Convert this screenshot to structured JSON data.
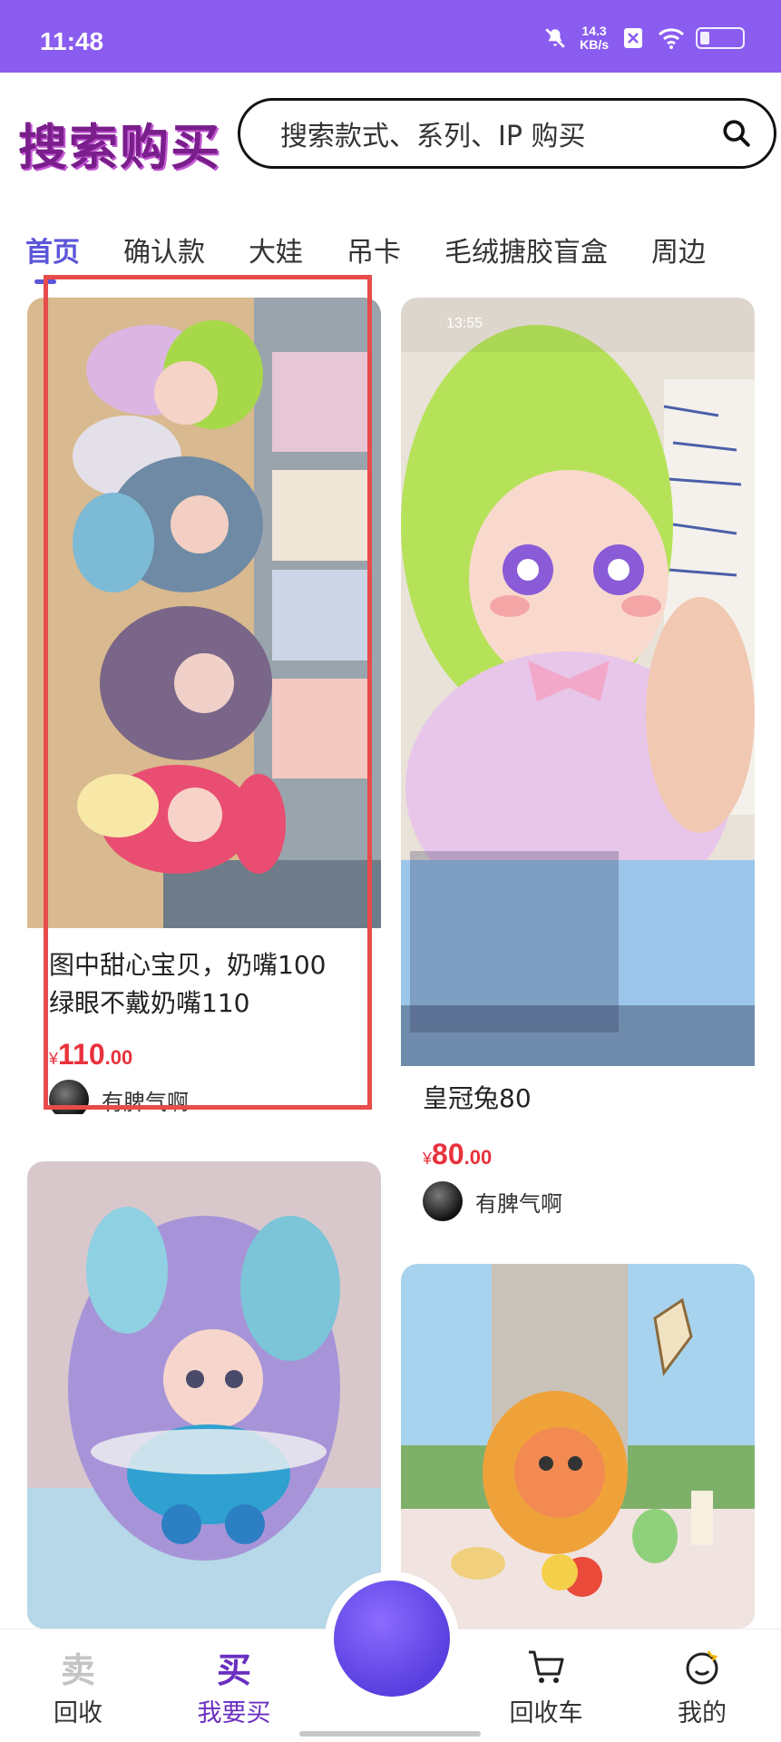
{
  "status_bar": {
    "time": "11:48",
    "net_speed_value": "14.3",
    "net_speed_unit": "KB/s",
    "icons": [
      "mute-icon",
      "no-sim-icon",
      "wifi-icon",
      "battery-icon"
    ]
  },
  "header": {
    "title": "搜索购买",
    "search_placeholder": "搜索款式、系列、IP 购买"
  },
  "tabs": [
    {
      "label": "首页",
      "active": true
    },
    {
      "label": "确认款",
      "active": false
    },
    {
      "label": "大娃",
      "active": false
    },
    {
      "label": "吊卡",
      "active": false
    },
    {
      "label": "毛绒搪胶盲盒",
      "active": false
    },
    {
      "label": "周边",
      "active": false
    }
  ],
  "cards": [
    {
      "title_line1": "图中甜心宝贝，奶嘴100",
      "title_line2": "绿眼不戴奶嘴110",
      "price_symbol": "¥",
      "price_int": "110",
      "price_dec": ".00",
      "seller": "有脾气啊"
    },
    {
      "title_line1": "皇冠兔80",
      "price_symbol": "¥",
      "price_int": "80",
      "price_dec": ".00",
      "seller": "有脾气啊",
      "overlay_time": "13:55"
    },
    {
      "title_line1": ""
    },
    {
      "title_line1": ""
    }
  ],
  "bottom_nav": {
    "items": [
      {
        "label": "回收",
        "icon_glyph": "卖",
        "icon": "sell-icon"
      },
      {
        "label": "我要买",
        "icon_glyph": "买",
        "icon": "buy-icon",
        "active": true
      },
      {
        "label": "回收车",
        "icon": "cart-icon"
      },
      {
        "label": "我的",
        "icon": "profile-face-icon"
      }
    ]
  },
  "colors": {
    "status_bar": "#8a5cf0",
    "accent": "#5b55d9",
    "title": "#7a1e8c",
    "price": "#e8323c",
    "highlight": "#e84b4b"
  }
}
